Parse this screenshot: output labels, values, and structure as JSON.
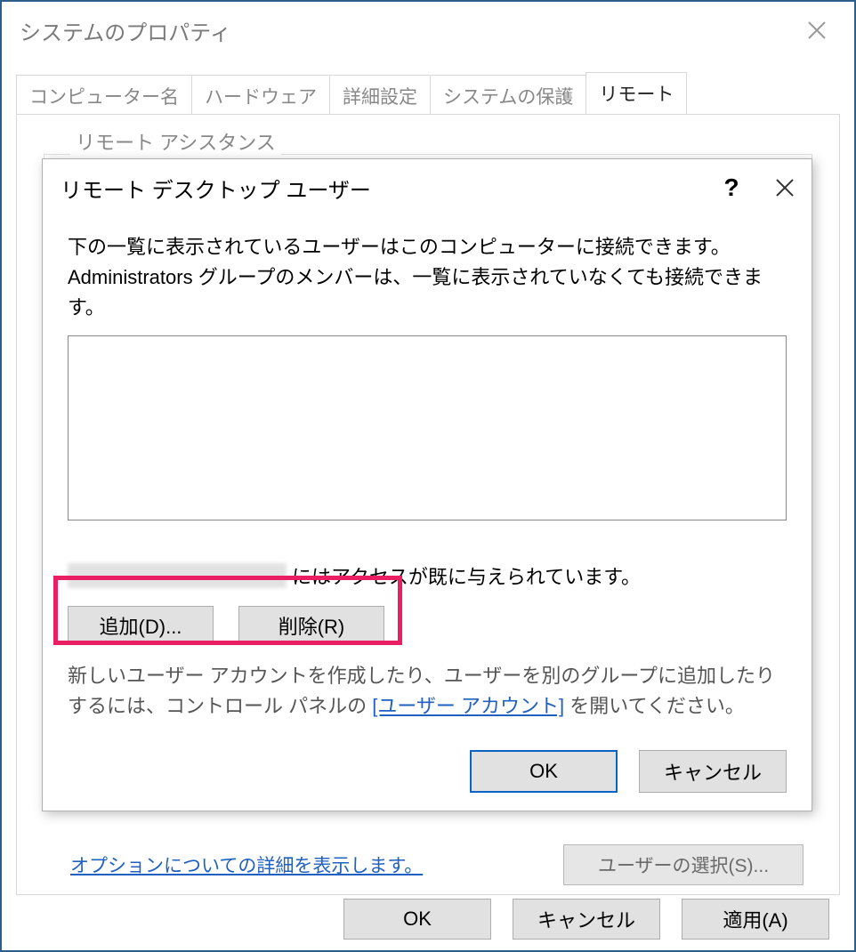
{
  "parent": {
    "title": "システムのプロパティ",
    "tabs": [
      {
        "label": "コンピューター名",
        "active": false
      },
      {
        "label": "ハードウェア",
        "active": false
      },
      {
        "label": "詳細設定",
        "active": false
      },
      {
        "label": "システムの保護",
        "active": false
      },
      {
        "label": "リモート",
        "active": true
      }
    ],
    "group_label": "リモート アシスタンス",
    "options_link": "オプションについての詳細を表示します。",
    "select_users_btn": "ユーザーの選択(S)...",
    "buttons": {
      "ok": "OK",
      "cancel": "キャンセル",
      "apply": "適用(A)"
    }
  },
  "modal": {
    "title": "リモート デスクトップ ユーザー",
    "help": "?",
    "description": "下の一覧に表示されているユーザーはこのコンピューターに接続できます。Administrators グループのメンバーは、一覧に表示されていなくても接続できます。",
    "access_suffix": "にはアクセスが既に与えられています。",
    "add_btn": "追加(D)...",
    "remove_btn": "削除(R)",
    "hint_prefix": "新しいユーザー アカウントを作成したり、ユーザーを別のグループに追加したりするには、コントロール パネルの ",
    "hint_link": "[ユーザー アカウント]",
    "hint_suffix": " を開いてください。",
    "buttons": {
      "ok": "OK",
      "cancel": "キャンセル"
    }
  }
}
